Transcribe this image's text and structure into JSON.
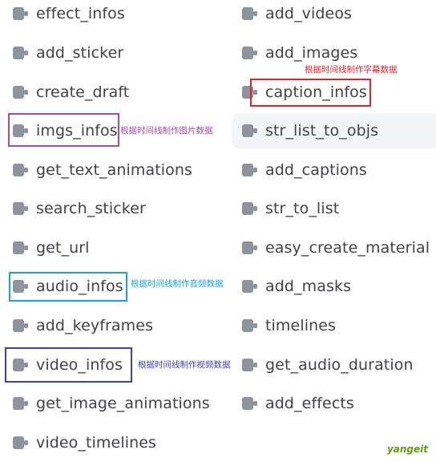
{
  "left_items": [
    "effect_infos",
    "add_sticker",
    "create_draft",
    "imgs_infos",
    "get_text_animations",
    "search_sticker",
    "get_url",
    "audio_infos",
    "add_keyframes",
    "video_infos",
    "get_image_animations",
    "video_timelines"
  ],
  "right_items": [
    "add_videos",
    "add_images",
    "caption_infos",
    "str_list_to_objs",
    "add_captions",
    "str_to_list",
    "easy_create_material",
    "add_masks",
    "timelines",
    "get_audio_duration",
    "add_effects"
  ],
  "notes": {
    "caption": "根据时间线制作字幕数据",
    "imgs": "根据时间线制作图片数据",
    "audio": "根据时间线制作音频数据",
    "video": "根据时间线制作视频数据"
  },
  "colors": {
    "caption": "#e0242b",
    "imgs": "#a44aa8",
    "audio": "#1aa3d6",
    "video": "#3f3fb7",
    "icon": "#8f939d",
    "text": "#3f4249",
    "hover_bg": "#f4f5f9"
  },
  "watermark": "yangeit"
}
